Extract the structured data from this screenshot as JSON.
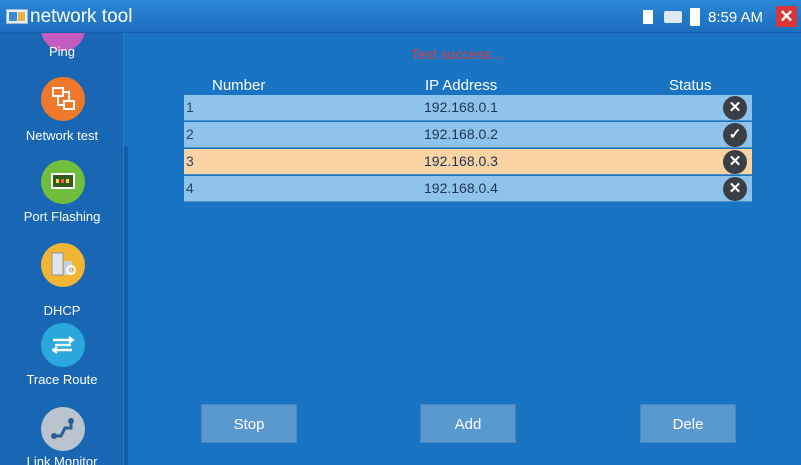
{
  "window": {
    "title": "network tool",
    "clock": "8:59 AM",
    "close_glyph": "✕"
  },
  "status_icons": [
    "sd-card-icon",
    "network-icon",
    "battery-icon"
  ],
  "sidebar": {
    "items": [
      {
        "label": "Ping",
        "icon": "ping-icon",
        "color": "#c45bbf"
      },
      {
        "label": "Network test",
        "icon": "network-test-icon",
        "color": "#f0782a"
      },
      {
        "label": "Port Flashing",
        "icon": "port-flashing-icon",
        "color": "#6fbe3c"
      },
      {
        "label": "DHCP",
        "icon": "dhcp-icon",
        "color": "#f2b531"
      },
      {
        "label": "Trace Route",
        "icon": "trace-route-icon",
        "color": "#2aa8de"
      },
      {
        "label": "Link Monitor",
        "icon": "link-monitor-icon",
        "color": "#b9c4cf"
      }
    ]
  },
  "main": {
    "status_message": "Test success...",
    "columns": [
      "Number",
      "IP Address",
      "Status"
    ],
    "rows": [
      {
        "number": "1",
        "ip": "192.168.0.1",
        "status": "fail",
        "glyph": "✕",
        "bg": "#8ec3ec"
      },
      {
        "number": "2",
        "ip": "192.168.0.2",
        "status": "success",
        "glyph": "✓",
        "bg": "#8ec3ec"
      },
      {
        "number": "3",
        "ip": "192.168.0.3",
        "status": "fail",
        "glyph": "✕",
        "bg": "#f9d3a2"
      },
      {
        "number": "4",
        "ip": "192.168.0.4",
        "status": "fail",
        "glyph": "✕",
        "bg": "#8ec3ec"
      }
    ],
    "buttons": {
      "stop": "Stop",
      "add": "Add",
      "delete": "Dele"
    }
  }
}
